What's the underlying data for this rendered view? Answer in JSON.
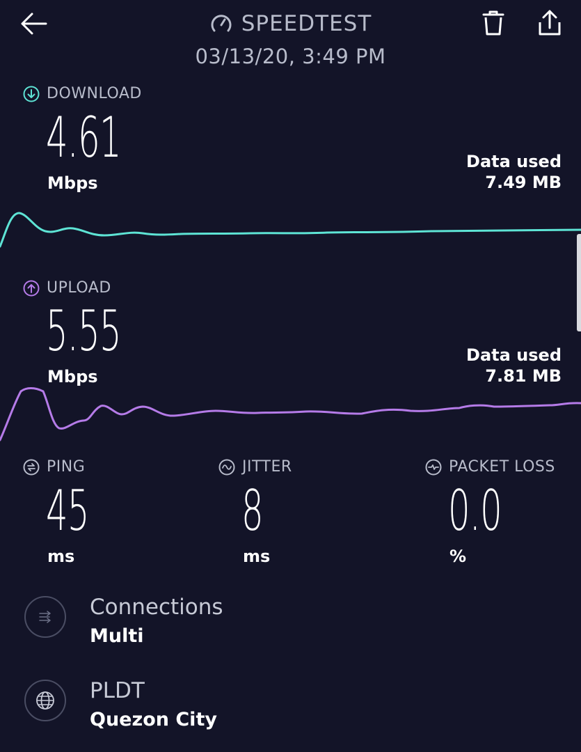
{
  "header": {
    "title": "SPEEDTEST",
    "timestamp": "03/13/20, 3:49 PM"
  },
  "download": {
    "label": "DOWNLOAD",
    "value": "4.61",
    "unit": "Mbps",
    "data_used_label": "Data used",
    "data_used_value": "7.49 MB",
    "color": "#5ee4d5"
  },
  "upload": {
    "label": "UPLOAD",
    "value": "5.55",
    "unit": "Mbps",
    "data_used_label": "Data used",
    "data_used_value": "7.81 MB",
    "color": "#b57be8"
  },
  "ping": {
    "label": "PING",
    "value": "45",
    "unit": "ms"
  },
  "jitter": {
    "label": "JITTER",
    "value": "8",
    "unit": "ms"
  },
  "packet_loss": {
    "label": "PACKET LOSS",
    "value": "0.0",
    "unit": "%"
  },
  "connections": {
    "title": "Connections",
    "value": "Multi"
  },
  "server": {
    "title": "PLDT",
    "location": "Quezon City"
  },
  "icons": {
    "back": "arrow-left-icon",
    "speed": "gauge-icon",
    "trash": "trash-icon",
    "share": "share-icon",
    "download": "download-arrow-icon",
    "upload": "upload-arrow-icon",
    "ping": "ping-icon",
    "jitter": "jitter-icon",
    "packet_loss": "packet-loss-icon",
    "connections": "connections-icon",
    "server": "globe-icon"
  },
  "colors": {
    "background": "#131428",
    "muted_text": "#b8bccb"
  }
}
